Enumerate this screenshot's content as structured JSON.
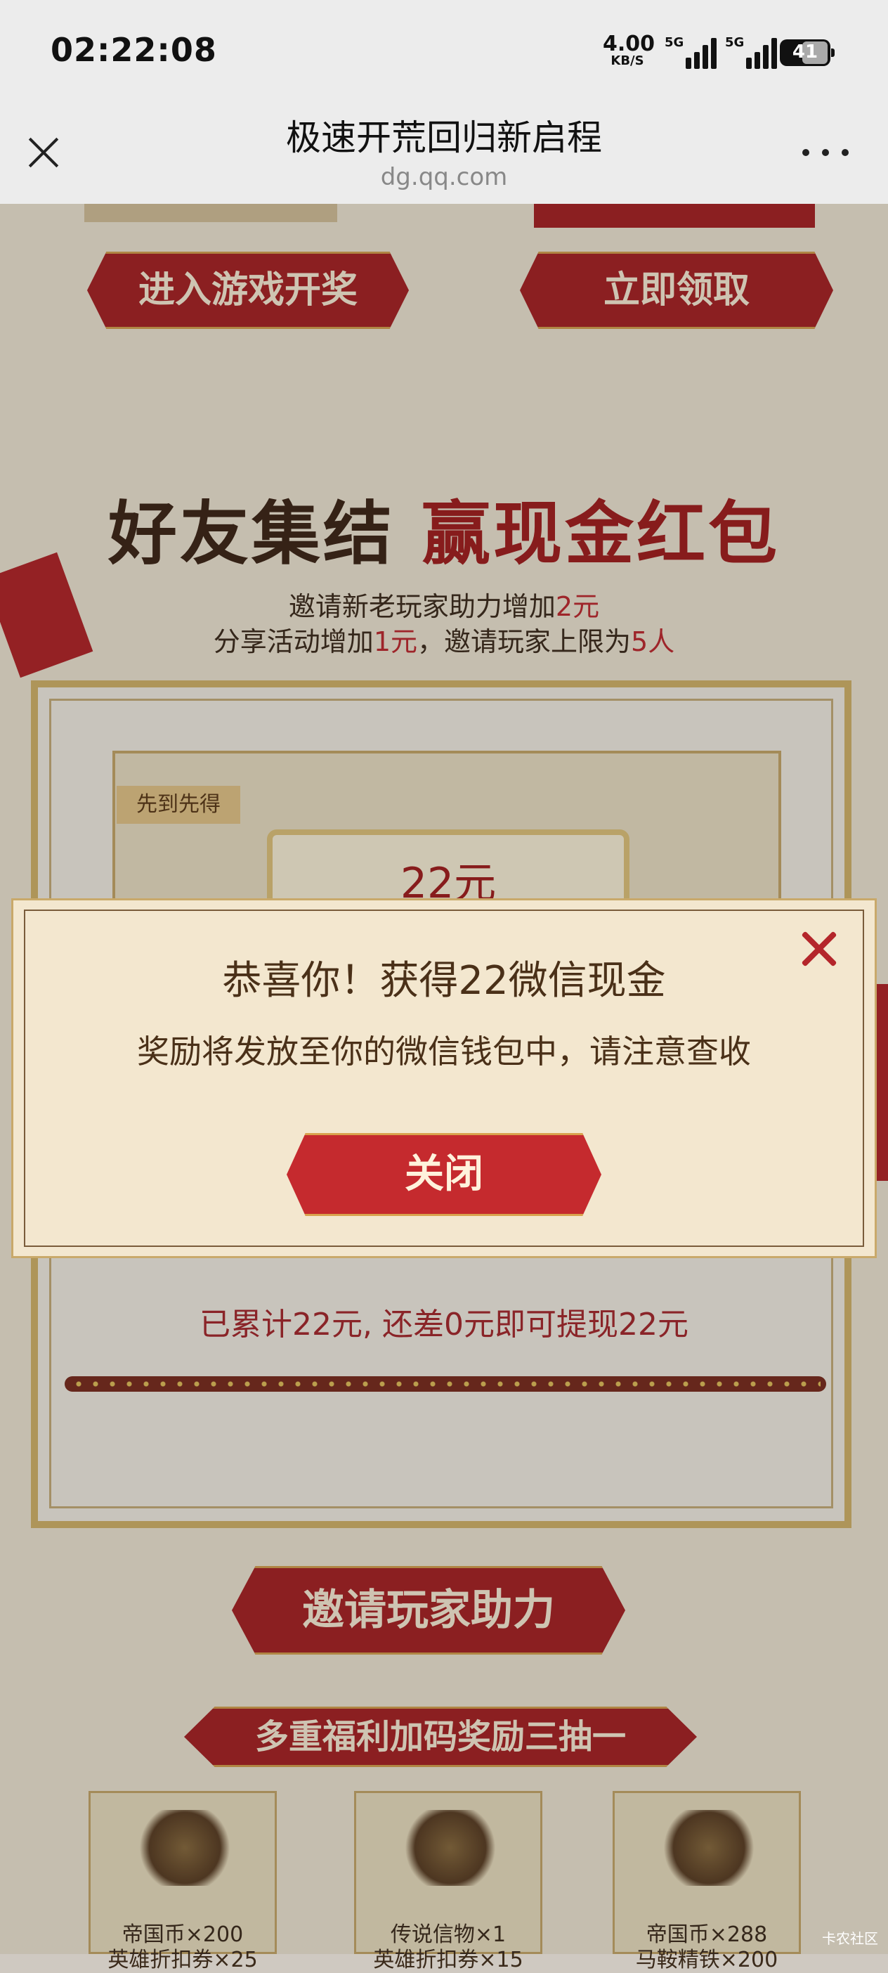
{
  "status_bar": {
    "time": "02:22:08",
    "net_speed_value": "4.00",
    "net_speed_unit": "KB/S",
    "sim1_tag": "5G",
    "sim2_tag": "5G",
    "battery": "41"
  },
  "nav": {
    "title": "极速开荒回归新启程",
    "domain": "dg.qq.com"
  },
  "page": {
    "btn_enter_game": "进入游戏开奖",
    "btn_claim": "立即领取",
    "section_title_part1": "好友集结",
    "section_title_part2": "赢现金红包",
    "sub1_text": "邀请新老玩家助力增加",
    "sub1_value": "2元",
    "sub2_text_a": "分享活动增加",
    "sub2_value_a": "1元",
    "sub2_text_b": "，邀请玩家上限为",
    "sub2_value_b": "5人",
    "badge": "先到先得",
    "prize_amount": "22元",
    "accumulated": "已累计22元, 还差0元即可提现22元",
    "btn_invite": "邀请玩家助力",
    "btn_bonus": "多重福利加码奖励三抽一",
    "rewards": [
      {
        "line1": "帝国币×200",
        "line2": "英雄折扣券×25"
      },
      {
        "line1": "传说信物×1",
        "line2": "英雄折扣券×15"
      },
      {
        "line1": "帝国币×288",
        "line2": "马鞍精铁×200"
      }
    ]
  },
  "modal": {
    "title": "恭喜你！获得22微信现金",
    "description": "奖励将发放至你的微信钱包中，请注意查收",
    "close_button": "关闭"
  },
  "watermark": "卡农社区",
  "colors": {
    "accent_red": "#c52a2e",
    "brown_text": "#4a3018",
    "parchment": "#f3e7cf"
  }
}
